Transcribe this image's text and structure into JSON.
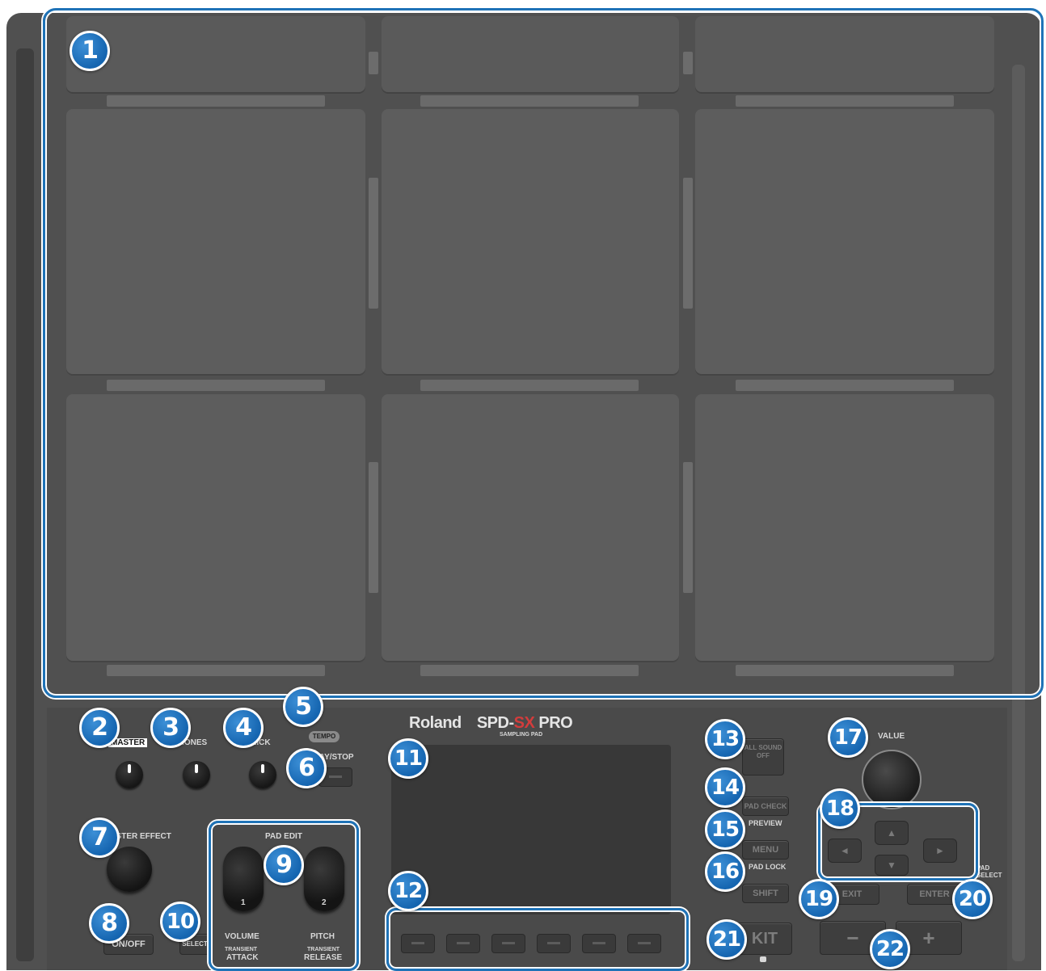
{
  "pads": [
    {
      "id": "pad-1"
    },
    {
      "id": "pad-2"
    },
    {
      "id": "pad-3"
    },
    {
      "id": "pad-4"
    },
    {
      "id": "pad-5"
    },
    {
      "id": "pad-6"
    },
    {
      "id": "pad-7"
    },
    {
      "id": "pad-8"
    },
    {
      "id": "pad-9"
    }
  ],
  "callouts": [
    "1",
    "2",
    "3",
    "4",
    "5",
    "6",
    "7",
    "8",
    "9",
    "10",
    "11",
    "12",
    "13",
    "14",
    "15",
    "16",
    "17",
    "18",
    "19",
    "20",
    "21",
    "22"
  ],
  "panel": {
    "master_label": "MASTER",
    "phones_label": "PHONES",
    "click_label": "CLICK",
    "tempo_label": "TEMPO",
    "play_stop_label": "PLAY/STOP",
    "master_effect_label": "MASTER EFFECT",
    "on_off_label": "ON/OFF",
    "select_label": "SELECT",
    "pad_edit_label": "PAD EDIT",
    "knob1_number": "1",
    "knob2_number": "2",
    "volume_label": "VOLUME",
    "pitch_label": "PITCH",
    "attack_top": "TRANSIENT",
    "attack_label": "ATTACK",
    "release_top": "TRANSIENT",
    "release_label": "RELEASE",
    "brand": "Roland",
    "model_a": "SPD-",
    "model_b": "SX",
    "model_c": " PRO",
    "model_sub": "SAMPLING PAD",
    "all_sound_off": "ALL SOUND OFF",
    "pad_check_label": "PAD CHECK",
    "preview_label": "PREVIEW",
    "menu_label": "MENU",
    "pad_lock_label": "PAD LOCK",
    "shift_label": "SHIFT",
    "exit_label": "EXIT",
    "enter_label": "ENTER",
    "pad_select_label": "PAD SELECT",
    "kit_label": "KIT",
    "value_label": "VALUE",
    "minus_label": "−",
    "plus_label": "+"
  },
  "colors": {
    "callout_blue": "#1565b0",
    "device_gray": "#505050",
    "accent_red": "#d33c3c"
  }
}
